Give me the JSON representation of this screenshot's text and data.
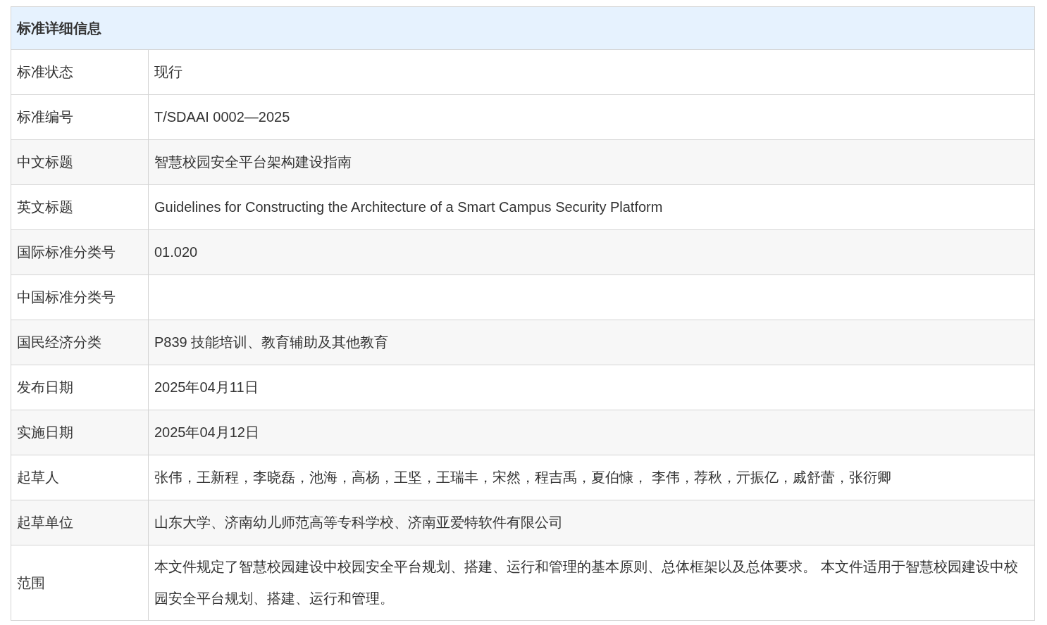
{
  "table": {
    "title": "标准详细信息",
    "rows": [
      {
        "label": "标准状态",
        "value": "现行"
      },
      {
        "label": "标准编号",
        "value": "T/SDAAI 0002—2025"
      },
      {
        "label": "中文标题",
        "value": "智慧校园安全平台架构建设指南"
      },
      {
        "label": "英文标题",
        "value": "Guidelines for Constructing the Architecture of a Smart Campus Security Platform"
      },
      {
        "label": "国际标准分类号",
        "value": "01.020"
      },
      {
        "label": "中国标准分类号"
      },
      {
        "label": "国民经济分类",
        "value": "P839 技能培训、教育辅助及其他教育"
      },
      {
        "label": "发布日期",
        "value": "2025年04月11日"
      },
      {
        "label": "实施日期",
        "value": "2025年04月12日"
      },
      {
        "label": "起草人",
        "value": "张伟，王新程，李晓磊，池海，高杨，王坚，王瑞丰，宋然，程吉禹，夏伯慷， 李伟，荐秋，亓振亿，戚舒蕾，张衍卿"
      },
      {
        "label": "起草单位",
        "value": "山东大学、济南幼儿师范高等专科学校、济南亚爱特软件有限公司"
      },
      {
        "label": "范围",
        "value": "本文件规定了智慧校园建设中校园安全平台规划、搭建、运行和管理的基本原则、总体框架以及总体要求。 本文件适用于智慧校园建设中校园安全平台规划、搭建、运行和管理。"
      }
    ]
  }
}
